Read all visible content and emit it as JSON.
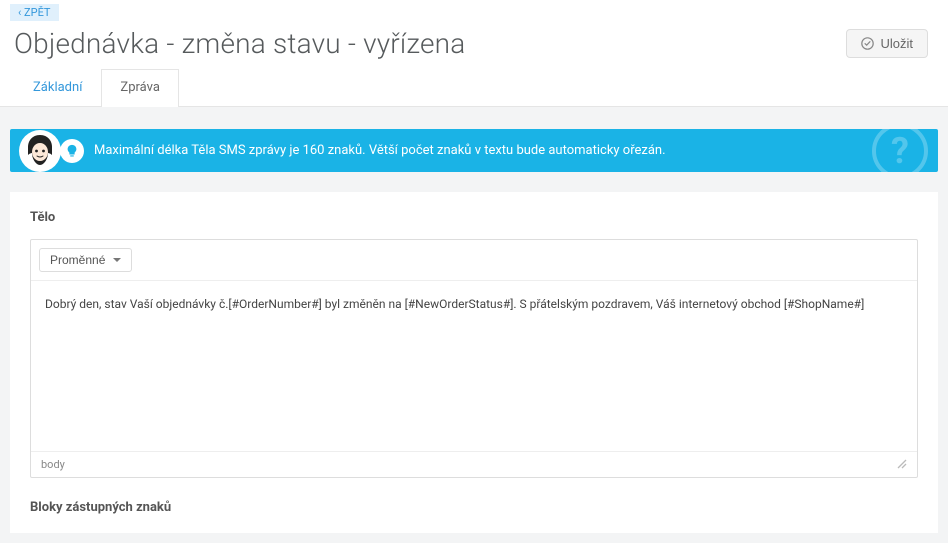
{
  "back": {
    "label": "ZPĚT"
  },
  "header": {
    "title": "Objednávka - změna stavu - vyřízena",
    "save_label": "Uložit"
  },
  "tabs": [
    {
      "label": "Základní",
      "active": false
    },
    {
      "label": "Zpráva",
      "active": true
    }
  ],
  "alert": {
    "text": "Maximální délka Těla SMS zprávy je 160 znaků. Větší počet znaků v textu bude automaticky ořezán."
  },
  "editor": {
    "label": "Tělo",
    "dropdown_label": "Proměnné",
    "body_text": "Dobrý den, stav Vaší objednávky č.[#OrderNumber#] byl změněn na [#NewOrderStatus#]. S přátelským pozdravem, Váš internetový obchod [#ShopName#]",
    "path": "body"
  },
  "placeholders_section": {
    "heading": "Bloky zástupných znaků"
  }
}
